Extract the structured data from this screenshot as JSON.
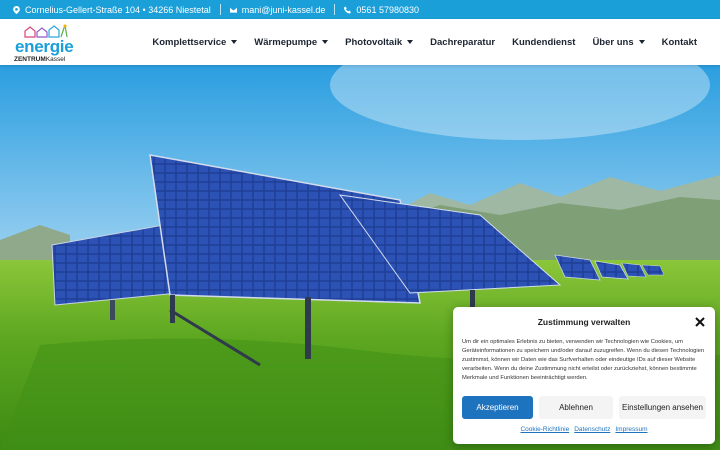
{
  "topbar": {
    "address": "Cornelius-Gellert-Straße 104 • 34266 Niestetal",
    "email": "mani@juni-kassel.de",
    "phone": "0561 57980830"
  },
  "logo": {
    "word": "energie",
    "sub_bold": "ZENTRUM",
    "sub_rest": "Kassel"
  },
  "nav": {
    "items": [
      {
        "label": "Komplettservice",
        "dropdown": true
      },
      {
        "label": "Wärmepumpe",
        "dropdown": true
      },
      {
        "label": "Photovoltaik",
        "dropdown": true
      },
      {
        "label": "Dachreparatur",
        "dropdown": false
      },
      {
        "label": "Kundendienst",
        "dropdown": false
      },
      {
        "label": "Über uns",
        "dropdown": true
      },
      {
        "label": "Kontakt",
        "dropdown": false
      }
    ]
  },
  "cookie": {
    "title": "Zustimmung verwalten",
    "text": "Um dir ein optimales Erlebnis zu bieten, verwenden wir Technologien wie Cookies, um Geräteinformationen zu speichern und/oder darauf zuzugreifen. Wenn du diesen Technologien zustimmst, können wir Daten wie das Surfverhalten oder eindeutige IDs auf dieser Website verarbeiten. Wenn du deine Zustimmung nicht erteilst oder zurückziehst, können bestimmte Merkmale und Funktionen beeinträchtigt werden.",
    "accept": "Akzeptieren",
    "deny": "Ablehnen",
    "settings": "Einstellungen ansehen",
    "links": [
      "Cookie-Richtlinie",
      "Datenschutz",
      "Impressum"
    ]
  },
  "colors": {
    "brand": "#1a9fd8",
    "accept_button": "#1e73be",
    "nav_text": "#1b2430"
  }
}
